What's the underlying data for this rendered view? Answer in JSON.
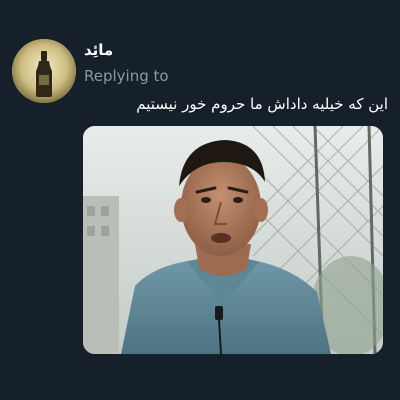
{
  "tweet": {
    "display_name": "مائِد",
    "replying_label": "Replying to",
    "text": "این که خیلیه داداش ما حروم خور نیستیم"
  },
  "avatar": {
    "icon": "bottle-avatar-icon"
  },
  "media": {
    "type": "video-still",
    "icon": "man-portrait-image"
  },
  "colors": {
    "background": "#15202b",
    "primary_text": "#ffffff",
    "secondary_text": "#8b98a5"
  }
}
